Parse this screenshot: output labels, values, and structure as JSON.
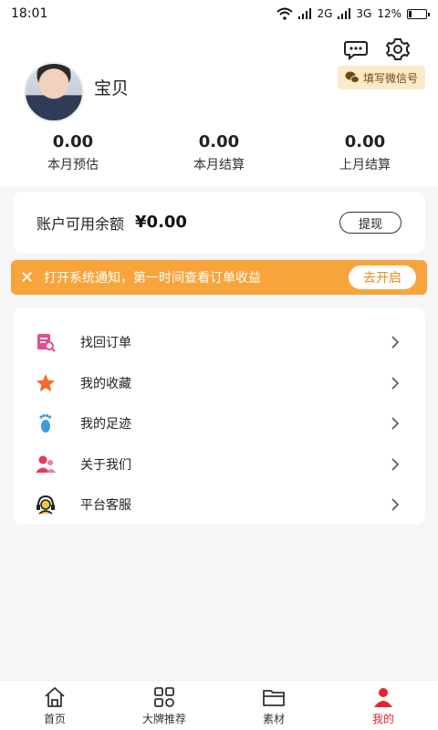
{
  "status_bar": {
    "time": "18:01",
    "network1": "2G",
    "network2": "3G",
    "battery": "12%"
  },
  "header": {
    "username": "宝贝",
    "wechat_button": "填写微信号",
    "icons": [
      "chat-icon",
      "gear-icon"
    ]
  },
  "stats": [
    {
      "value": "0.00",
      "label": "本月预估"
    },
    {
      "value": "0.00",
      "label": "本月结算"
    },
    {
      "value": "0.00",
      "label": "上月结算"
    }
  ],
  "balance": {
    "label": "账户可用余额",
    "amount": "¥0.00",
    "withdraw_label": "提现"
  },
  "notice": {
    "text": "打开系统通知，第一时间查看订单收益",
    "button": "去开启"
  },
  "menu": [
    {
      "label": "找回订单",
      "icon": "order-search-icon",
      "color": "#e84a8a"
    },
    {
      "label": "我的收藏",
      "icon": "star-icon",
      "color": "#f36a2a"
    },
    {
      "label": "我的足迹",
      "icon": "footprint-icon",
      "color": "#3a9de0"
    },
    {
      "label": "关于我们",
      "icon": "users-icon",
      "color": "#e23b5b"
    },
    {
      "label": "平台客服",
      "icon": "headset-icon",
      "color": "#222222"
    }
  ],
  "tabs": [
    {
      "label": "首页",
      "icon": "home-icon"
    },
    {
      "label": "大牌推荐",
      "icon": "grid-icon"
    },
    {
      "label": "素材",
      "icon": "folder-icon"
    },
    {
      "label": "我的",
      "icon": "profile-icon",
      "active": true
    }
  ],
  "colors": {
    "accent": "#f7a53a",
    "active_tab": "#e8222f"
  }
}
